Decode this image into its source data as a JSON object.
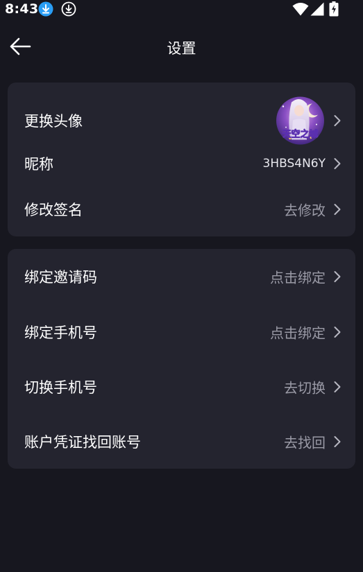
{
  "status_bar": {
    "time": "8:43",
    "icons": [
      "download-filled-icon",
      "download-outline-icon",
      "wifi-icon",
      "signal-icon",
      "battery-charging-icon"
    ]
  },
  "header": {
    "title": "设置",
    "back_icon": "arrow-left-icon"
  },
  "profile_section": {
    "avatar": {
      "label": "更换头像",
      "image_text": "天空之城"
    },
    "nickname": {
      "label": "昵称",
      "value": "3HBS4N6Y"
    },
    "signature": {
      "label": "修改签名",
      "value": "去修改"
    }
  },
  "account_section": {
    "invite_code": {
      "label": "绑定邀请码",
      "value": "点击绑定"
    },
    "bind_phone": {
      "label": "绑定手机号",
      "value": "点击绑定"
    },
    "switch_phone": {
      "label": "切换手机号",
      "value": "去切换"
    },
    "recover": {
      "label": "账户凭证找回账号",
      "value": "去找回"
    }
  },
  "colors": {
    "background": "#17171f",
    "card": "#24242f",
    "value_text": "#9a9aa6",
    "accent_blue": "#2a9df4"
  }
}
